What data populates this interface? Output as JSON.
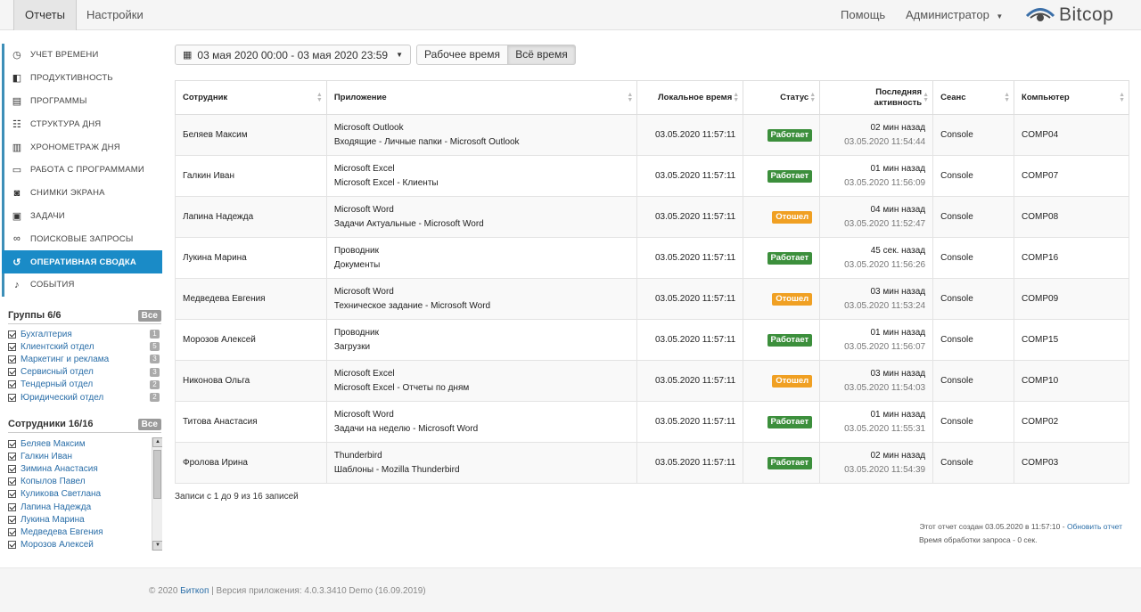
{
  "topbar": {
    "tabs": [
      "Отчеты",
      "Настройки"
    ],
    "help": "Помощь",
    "user": "Администратор",
    "logo_text": "Bitcop"
  },
  "sidebar": {
    "nav": [
      {
        "label": "Учет времени",
        "icon": "clock-icon"
      },
      {
        "label": "Продуктивность",
        "icon": "stack-icon"
      },
      {
        "label": "Программы",
        "icon": "windows-icon"
      },
      {
        "label": "Структура дня",
        "icon": "list-icon"
      },
      {
        "label": "Хронометраж дня",
        "icon": "timeline-icon"
      },
      {
        "label": "Работа с программами",
        "icon": "monitor-icon"
      },
      {
        "label": "Снимки экрана",
        "icon": "camera-icon"
      },
      {
        "label": "Задачи",
        "icon": "clipboard-icon"
      },
      {
        "label": "Поисковые запросы",
        "icon": "binoculars-icon"
      },
      {
        "label": "Оперативная сводка",
        "icon": "history-icon"
      },
      {
        "label": "События",
        "icon": "bell-icon"
      }
    ],
    "groups_title": "Группы 6/6",
    "all_label": "Все",
    "groups": [
      {
        "name": "Бухгалтерия",
        "count": "1"
      },
      {
        "name": "Клиентский отдел",
        "count": "5"
      },
      {
        "name": "Маркетинг и реклама",
        "count": "3"
      },
      {
        "name": "Сервисный отдел",
        "count": "3"
      },
      {
        "name": "Тендерный отдел",
        "count": "2"
      },
      {
        "name": "Юридический отдел",
        "count": "2"
      }
    ],
    "employees_title": "Сотрудники 16/16",
    "employees": [
      "Беляев Максим",
      "Галкин Иван",
      "Зимина Анастасия",
      "Копылов Павел",
      "Куликова Светлана",
      "Лапина Надежда",
      "Лукина Марина",
      "Медведева Евгения",
      "Морозов Алексей"
    ]
  },
  "filters": {
    "date_range": "03 мая 2020 00:00 - 03 мая 2020 23:59",
    "work_time": "Рабочее время",
    "all_time": "Всё время"
  },
  "table": {
    "headers": [
      "Сотрудник",
      "Приложение",
      "Локальное время",
      "Статус",
      "Последняя активность",
      "Сеанс",
      "Компьютер"
    ],
    "rows": [
      {
        "employee": "Беляев Максим",
        "app": "Microsoft Outlook",
        "window": "Входящие - Личные папки - Microsoft Outlook",
        "time": "03.05.2020 11:57:11",
        "status": "Работает",
        "ago": "02 мин назад",
        "last": "03.05.2020 11:54:44",
        "session": "Console",
        "computer": "COMP04"
      },
      {
        "employee": "Галкин Иван",
        "app": "Microsoft Excel",
        "window": "Microsoft Excel - Клиенты",
        "time": "03.05.2020 11:57:11",
        "status": "Работает",
        "ago": "01 мин назад",
        "last": "03.05.2020 11:56:09",
        "session": "Console",
        "computer": "COMP07"
      },
      {
        "employee": "Лапина Надежда",
        "app": "Microsoft Word",
        "window": "Задачи Актуальные - Microsoft Word",
        "time": "03.05.2020 11:57:11",
        "status": "Отошел",
        "ago": "04 мин назад",
        "last": "03.05.2020 11:52:47",
        "session": "Console",
        "computer": "COMP08"
      },
      {
        "employee": "Лукина Марина",
        "app": "Проводник",
        "window": "Документы",
        "time": "03.05.2020 11:57:11",
        "status": "Работает",
        "ago": "45 сек. назад",
        "last": "03.05.2020 11:56:26",
        "session": "Console",
        "computer": "COMP16"
      },
      {
        "employee": "Медведева Евгения",
        "app": "Microsoft Word",
        "window": "Техническое задание - Microsoft Word",
        "time": "03.05.2020 11:57:11",
        "status": "Отошел",
        "ago": "03 мин назад",
        "last": "03.05.2020 11:53:24",
        "session": "Console",
        "computer": "COMP09"
      },
      {
        "employee": "Морозов Алексей",
        "app": "Проводник",
        "window": "Загрузки",
        "time": "03.05.2020 11:57:11",
        "status": "Работает",
        "ago": "01 мин назад",
        "last": "03.05.2020 11:56:07",
        "session": "Console",
        "computer": "COMP15"
      },
      {
        "employee": "Никонова Ольга",
        "app": "Microsoft Excel",
        "window": "Microsoft Excel - Отчеты по дням",
        "time": "03.05.2020 11:57:11",
        "status": "Отошел",
        "ago": "03 мин назад",
        "last": "03.05.2020 11:54:03",
        "session": "Console",
        "computer": "COMP10"
      },
      {
        "employee": "Титова Анастасия",
        "app": "Microsoft Word",
        "window": "Задачи на неделю - Microsoft Word",
        "time": "03.05.2020 11:57:11",
        "status": "Работает",
        "ago": "01 мин назад",
        "last": "03.05.2020 11:55:31",
        "session": "Console",
        "computer": "COMP02"
      },
      {
        "employee": "Фролова Ирина",
        "app": "Thunderbird",
        "window": "Шаблоны - Mozilla Thunderbird",
        "time": "03.05.2020 11:57:11",
        "status": "Работает",
        "ago": "02 мин назад",
        "last": "03.05.2020 11:54:39",
        "session": "Console",
        "computer": "COMP03"
      }
    ],
    "records_info": "Записи с 1 до 9 из 16 записей"
  },
  "colors": {
    "working": "#3c8f3c",
    "away": "#f0a023",
    "accent": "#1a8bc7"
  },
  "report": {
    "created": "Этот отчет создан 03.05.2020 в 11:57:10 - ",
    "refresh": "Обновить отчет",
    "processing": "Время обработки запроса - 0 сек."
  },
  "footer": {
    "prefix": "© 2020 ",
    "brand": "Биткоп",
    "version": " | Версия приложения: 4.0.3.3410 Demo (16.09.2019)"
  }
}
